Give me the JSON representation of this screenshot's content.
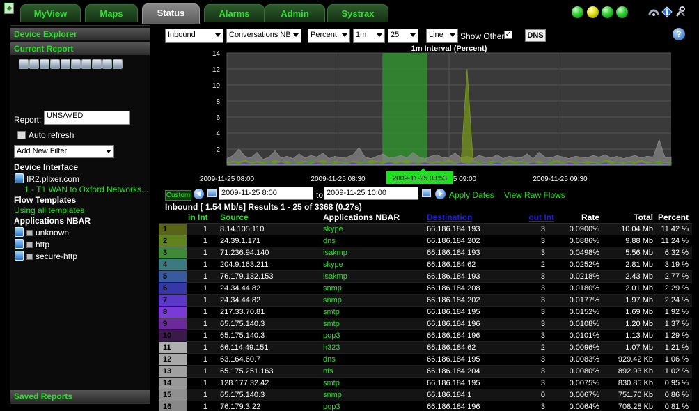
{
  "tabs": [
    {
      "label": "MyView"
    },
    {
      "label": "Maps"
    },
    {
      "label": "Status"
    },
    {
      "label": "Alarms"
    },
    {
      "label": "Admin"
    },
    {
      "label": "Systrax"
    }
  ],
  "active_tab": "Status",
  "status_leds": [
    "green",
    "yellow",
    "green",
    "green"
  ],
  "toolbar_icons_right": [
    "routers-icon",
    "info-icon",
    "tools-icon"
  ],
  "left_panel": {
    "device_explorer": "Device Explorer",
    "current_report": "Current Report",
    "tool_icons": [
      "flow-icon",
      "save-icon",
      "save-as-icon",
      "schedule-icon",
      "print-icon",
      "export-icon",
      "email-icon",
      "feed-icon",
      "pdf-icon",
      "copy-icon"
    ],
    "report_label": "Report:",
    "report_value": "UNSAVED",
    "auto_refresh": "Auto refresh",
    "add_filter": "Add New Filter",
    "device_interface_heading": "Device Interface",
    "device_name": "IR2.plixer.com",
    "interface_name": "1 - T1 WAN to Oxford Networks...",
    "flow_templates_heading": "Flow Templates",
    "flow_templates_value": "Using all templates",
    "apps_heading": "Applications NBAR",
    "apps": [
      "unknown",
      "http",
      "secure-http"
    ],
    "saved_reports": "Saved Reports"
  },
  "controls": {
    "direction": "Inbound",
    "report_type": "Conversations NB",
    "unit": "Percent",
    "interval": "1m",
    "count": "25",
    "graph_type": "Line",
    "show_other": "Show Other",
    "show_other_checked": true,
    "dns": "DNS"
  },
  "chart_data": {
    "type": "area",
    "title": "1m Interval (Percent)",
    "ylim": [
      0,
      14
    ],
    "yticks": [
      "14",
      "12",
      "10",
      "8",
      "6",
      "4",
      "2"
    ],
    "x_ticks": [
      "2009-11-25 08:00",
      "2009-11-25 08:30",
      "2009-11-25 09:00",
      "2009-11-25 09:30"
    ],
    "highlight_range": [
      "2009-11-25 08:42",
      "2009-11-25 08:54"
    ],
    "tooltip": "2009-11-25 08:53",
    "grid": true,
    "series": [
      {
        "color": "#8a8a8a",
        "values": [
          0.8,
          1.2,
          2.0,
          1.1,
          0.9,
          1.6,
          0.7,
          1.0,
          1.8,
          0.9,
          1.1,
          0.8,
          1.4,
          0.9,
          1.2,
          1.0,
          1.5,
          0.8,
          1.1,
          0.9,
          1.0,
          1.3,
          2.2,
          1.0,
          0.8,
          1.1,
          1.4,
          0.9,
          1.0,
          1.2,
          0.9,
          1.6,
          1.0,
          0.8,
          1.1,
          1.3,
          0.9,
          1.0,
          1.5,
          0.9,
          1.1,
          0.8,
          1.2,
          1.0,
          0.9,
          1.3,
          0.8,
          1.1,
          1.0,
          0.9,
          1.4,
          0.8,
          1.6,
          1.0,
          0.9,
          1.2,
          1.0,
          0.8,
          1.1,
          1.0,
          0.9,
          1.2,
          1.0,
          1.3,
          0.9,
          1.1,
          0.8,
          1.0,
          1.2,
          0.9,
          1.1,
          1.0,
          3.2,
          0.9,
          1.0
        ]
      },
      {
        "color": "#7a9a1a",
        "values": [
          0.3,
          0.5,
          0.4,
          0.6,
          0.3,
          0.5,
          0.4,
          0.3,
          0.6,
          0.4,
          0.5,
          0.3,
          0.4,
          0.5,
          0.3,
          0.4,
          0.6,
          0.3,
          0.5,
          0.4,
          0.3,
          0.5,
          0.4,
          0.3,
          0.6,
          0.5,
          0.4,
          0.3,
          0.5,
          0.4,
          0.6,
          0.3,
          0.4,
          0.5,
          0.3,
          0.5,
          0.4,
          0.6,
          0.3,
          0.4,
          12.0,
          0.5,
          0.4,
          0.3,
          0.5,
          0.4,
          0.3,
          0.6,
          0.4,
          0.5,
          0.3,
          0.4,
          0.5,
          0.3,
          0.4,
          0.6,
          0.3,
          0.5,
          0.4,
          0.3,
          0.5,
          0.4,
          0.3,
          0.6,
          0.5,
          0.4,
          0.3,
          0.5,
          0.4,
          0.6,
          0.3,
          0.4,
          0.5,
          0.3,
          0.4
        ]
      },
      {
        "color": "#4a9a2a",
        "values": [
          0.2,
          0.3,
          0.2,
          0.4,
          0.2,
          0.3,
          0.2,
          0.5,
          0.2,
          0.3,
          0.2,
          0.4,
          0.2,
          0.3,
          0.6,
          0.2,
          0.3,
          0.2,
          0.4,
          0.2,
          0.3,
          0.2,
          0.3,
          0.5,
          0.2,
          0.3,
          0.2,
          0.4,
          0.2,
          0.3,
          0.2,
          0.3,
          0.4,
          0.2,
          0.3,
          0.2,
          0.4,
          0.2,
          0.3,
          0.2,
          0.3,
          0.2,
          0.4,
          0.2,
          0.3,
          0.5,
          0.2,
          0.3,
          0.2,
          0.4,
          0.2,
          0.3,
          0.2,
          0.3,
          0.4,
          0.2,
          0.3,
          0.2,
          0.4,
          0.2,
          0.3,
          0.2,
          0.3,
          0.5,
          0.2,
          0.3,
          0.2,
          0.4,
          0.2,
          0.3,
          0.2,
          0.3,
          0.4,
          0.2,
          0.3
        ]
      },
      {
        "color": "#6a3ad0",
        "values": [
          0.1,
          0.2,
          0.1,
          0.3,
          0.1,
          0.2,
          0.1,
          0.2,
          0.1,
          0.3,
          0.1,
          0.2,
          0.1,
          0.2,
          0.1,
          0.3,
          0.1,
          0.2,
          0.1,
          0.2,
          0.1,
          0.3,
          0.1,
          0.2,
          0.1,
          0.2,
          0.1,
          0.3,
          0.1,
          0.2,
          0.1,
          0.2,
          0.1,
          0.3,
          0.1,
          0.2,
          0.1,
          0.2,
          0.1,
          0.3,
          0.1,
          0.2,
          0.1,
          0.2,
          0.1,
          0.3,
          0.1,
          0.2,
          0.1,
          0.2,
          0.1,
          0.3,
          0.1,
          0.2,
          0.1,
          0.2,
          0.1,
          0.3,
          0.1,
          0.2,
          0.1,
          0.2,
          0.1,
          0.3,
          0.1,
          0.2,
          0.1,
          0.2,
          0.1,
          0.3,
          0.1,
          0.2,
          0.1,
          0.2,
          0.1
        ]
      }
    ]
  },
  "date_range": {
    "custom": "Custom",
    "from": "2009-11-25 8:00",
    "to_label": "to",
    "to": "2009-11-25 10:00",
    "apply": "Apply Dates",
    "raw_flows": "View Raw Flows"
  },
  "summary": "Inbound [ 1.54 Mb/s] Results 1 - 25 of 3368 (0.27s)",
  "table": {
    "headers": {
      "in_int": "in Int",
      "source": "Source",
      "app": "Applications NBAR",
      "destination": "Destination",
      "out_int": "out Int",
      "rate": "Rate",
      "total": "Total",
      "percent": "Percent"
    },
    "rows": [
      {
        "rank": "1",
        "color": "#5a6418",
        "in_int": "1",
        "source": "8.14.105.110",
        "app": "skype",
        "destination": "66.186.184.193",
        "out_int": "3",
        "rate": "0.0900%",
        "total": "10.04 Mb",
        "percent": "11.42 %"
      },
      {
        "rank": "2",
        "color": "#60841c",
        "in_int": "1",
        "source": "24.39.1.171",
        "app": "dns",
        "destination": "66.186.184.202",
        "out_int": "3",
        "rate": "0.0886%",
        "total": "9.88 Mb",
        "percent": "11.24 %"
      },
      {
        "rank": "3",
        "color": "#3e8a38",
        "in_int": "1",
        "source": "71.236.94.140",
        "app": "isakmp",
        "destination": "66.186.184.193",
        "out_int": "3",
        "rate": "0.0498%",
        "total": "5.56 Mb",
        "percent": "6.32 %"
      },
      {
        "rank": "4",
        "color": "#3a7a80",
        "in_int": "1",
        "source": "204.9.163.211",
        "app": "skype",
        "destination": "66.186.184.62",
        "out_int": "2",
        "rate": "0.0252%",
        "total": "2.81 Mb",
        "percent": "3.19 %"
      },
      {
        "rank": "5",
        "color": "#3a5aa0",
        "in_int": "1",
        "source": "76.179.132.153",
        "app": "isakmp",
        "destination": "66.186.184.193",
        "out_int": "3",
        "rate": "0.0218%",
        "total": "2.43 Mb",
        "percent": "2.77 %"
      },
      {
        "rank": "6",
        "color": "#3638a8",
        "in_int": "1",
        "source": "24.34.44.82",
        "app": "snmp",
        "destination": "66.186.184.208",
        "out_int": "3",
        "rate": "0.0180%",
        "total": "2.01 Mb",
        "percent": "2.29 %"
      },
      {
        "rank": "7",
        "color": "#5a38c8",
        "in_int": "1",
        "source": "24.34.44.82",
        "app": "snmp",
        "destination": "66.186.184.202",
        "out_int": "3",
        "rate": "0.0177%",
        "total": "1.97 Mb",
        "percent": "2.24 %"
      },
      {
        "rank": "8",
        "color": "#7a3ad8",
        "in_int": "1",
        "source": "217.33.70.81",
        "app": "smtp",
        "destination": "66.186.184.195",
        "out_int": "3",
        "rate": "0.0152%",
        "total": "1.69 Mb",
        "percent": "1.92 %"
      },
      {
        "rank": "9",
        "color": "#6a2a9a",
        "in_int": "1",
        "source": "65.175.140.3",
        "app": "smtp",
        "destination": "66.186.184.196",
        "out_int": "3",
        "rate": "0.0108%",
        "total": "1.20 Mb",
        "percent": "1.37 %"
      },
      {
        "rank": "10",
        "color": "#3a1a48",
        "in_int": "1",
        "source": "65.175.140.3",
        "app": "pop3",
        "destination": "66.186.184.196",
        "out_int": "3",
        "rate": "0.0101%",
        "total": "1.13 Mb",
        "percent": "1.29 %"
      },
      {
        "rank": "11",
        "color": "#b0b0b0",
        "in_int": "1",
        "source": "66.114.49.151",
        "app": "h323",
        "destination": "66.186.184.62",
        "out_int": "2",
        "rate": "0.0096%",
        "total": "1.07 Mb",
        "percent": "1.21 %"
      },
      {
        "rank": "12",
        "color": "#a8a8a8",
        "in_int": "1",
        "source": "63.164.60.7",
        "app": "dns",
        "destination": "66.186.184.195",
        "out_int": "3",
        "rate": "0.0083%",
        "total": "929.42 Kb",
        "percent": "1.06 %"
      },
      {
        "rank": "13",
        "color": "#a0a0a0",
        "in_int": "1",
        "source": "65.175.251.163",
        "app": "nfs",
        "destination": "66.186.184.204",
        "out_int": "3",
        "rate": "0.0080%",
        "total": "892.93 Kb",
        "percent": "1.02 %"
      },
      {
        "rank": "14",
        "color": "#989898",
        "in_int": "1",
        "source": "128.177.32.42",
        "app": "smtp",
        "destination": "66.186.184.195",
        "out_int": "3",
        "rate": "0.0075%",
        "total": "830.85 Kb",
        "percent": "0.95 %"
      },
      {
        "rank": "15",
        "color": "#909090",
        "in_int": "1",
        "source": "65.175.140.3",
        "app": "snmp",
        "destination": "66.186.184.1",
        "out_int": "0",
        "rate": "0.0067%",
        "total": "751.70 Kb",
        "percent": "0.86 %"
      },
      {
        "rank": "16",
        "color": "#888888",
        "in_int": "1",
        "source": "76.179.3.22",
        "app": "pop3",
        "destination": "66.186.184.196",
        "out_int": "3",
        "rate": "0.0064%",
        "total": "708.28 Kb",
        "percent": "0.81 %"
      }
    ]
  }
}
